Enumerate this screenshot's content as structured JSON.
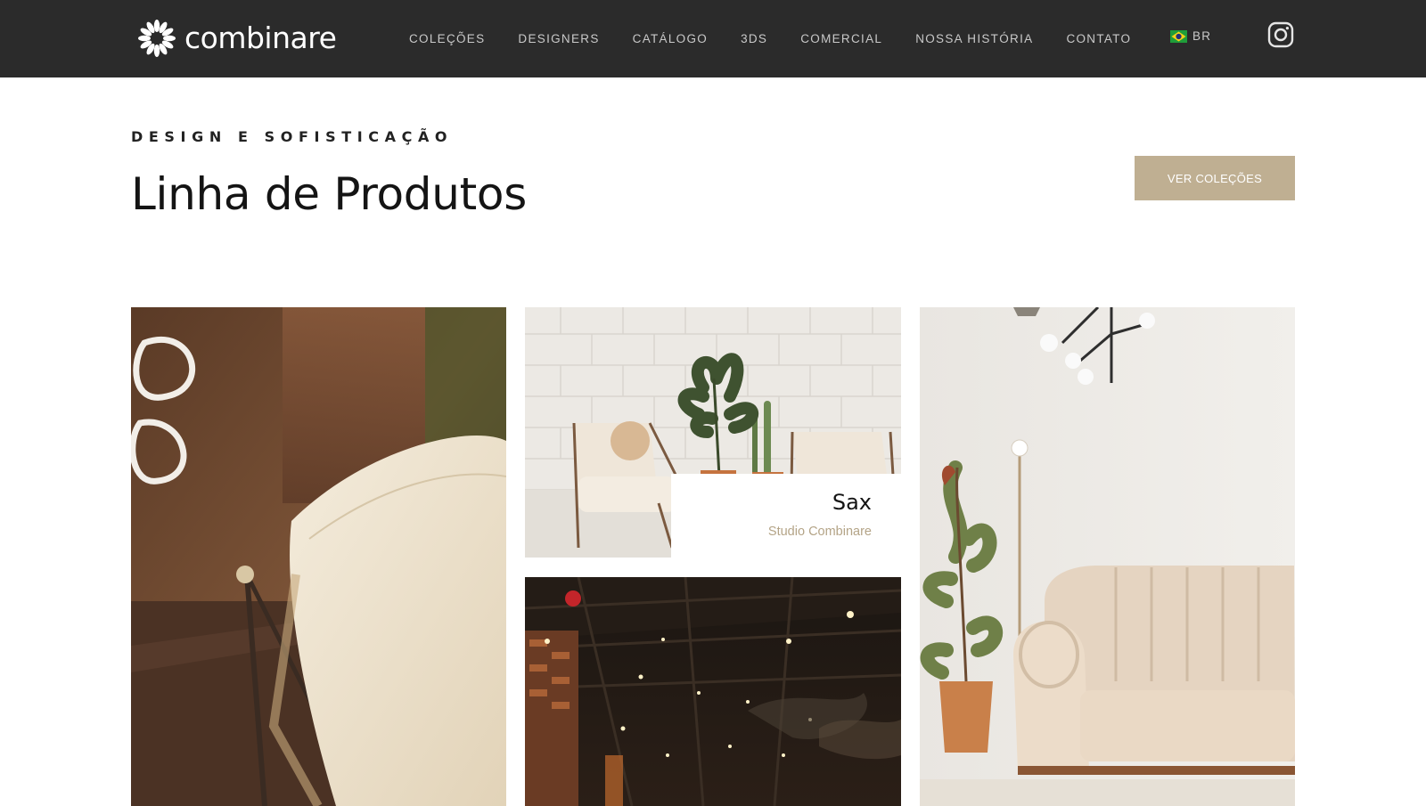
{
  "brand": {
    "name": "combinare",
    "logo_icon": "flower-burst-icon"
  },
  "nav": {
    "items": [
      {
        "label": "COLEÇÕES"
      },
      {
        "label": "DESIGNERS"
      },
      {
        "label": "CATÁLOGO"
      },
      {
        "label": "3DS"
      },
      {
        "label": "COMERCIAL"
      },
      {
        "label": "NOSSA HISTÓRIA"
      },
      {
        "label": "CONTATO"
      }
    ],
    "language": {
      "label": "BR",
      "flag_icon": "brazil-flag-icon"
    },
    "social_icon": "instagram-icon"
  },
  "hero": {
    "eyebrow": "DESIGN E SOFISTICAÇÃO",
    "title": "Linha de Produtos",
    "cta_label": "VER COLEÇÕES"
  },
  "gallery": {
    "featured": {
      "title": "Sax",
      "subtitle": "Studio Combinare"
    }
  },
  "colors": {
    "header_bg": "#2b2b2b",
    "accent": "#bfaf92",
    "accent_text": "#b4a487"
  }
}
